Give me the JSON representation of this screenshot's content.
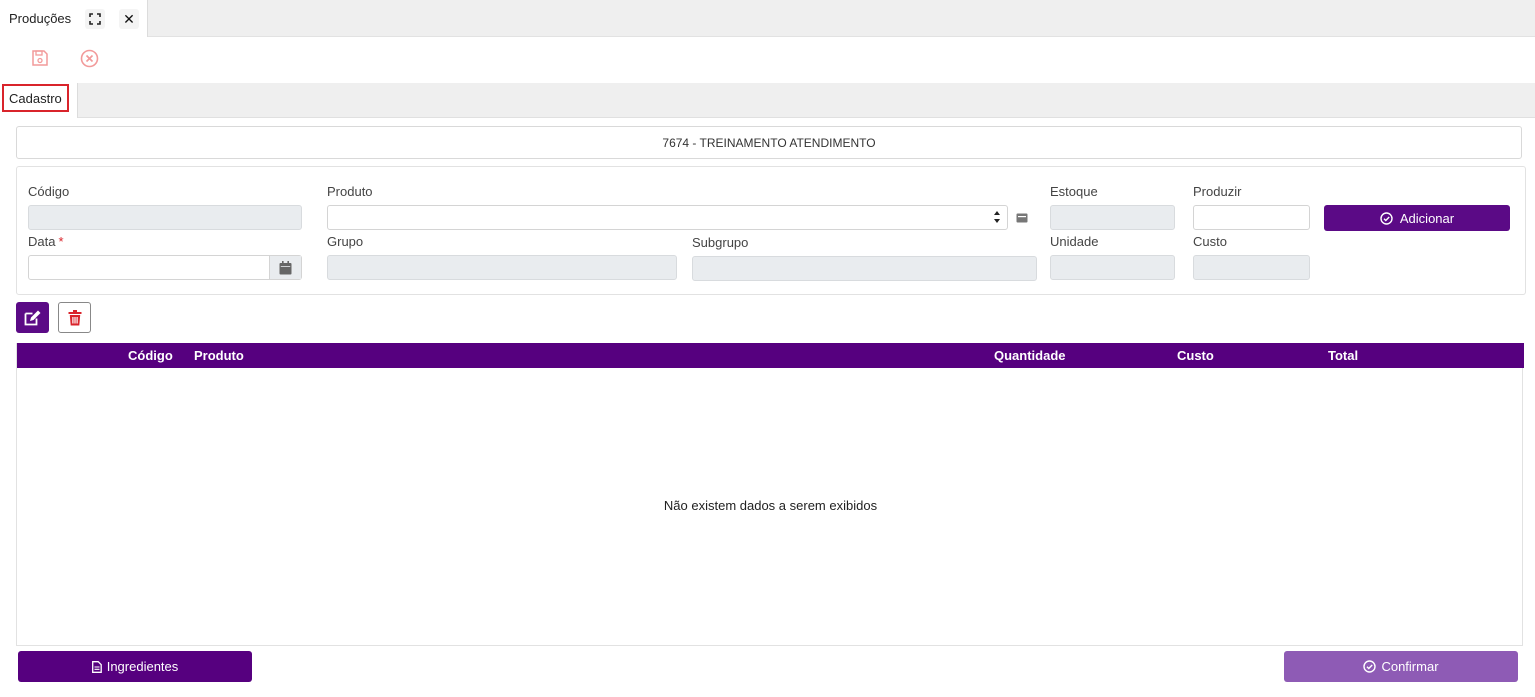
{
  "window": {
    "tab_title": "Produções",
    "expand_icon": "expand-icon",
    "close_icon": "close-icon",
    "close_glyph": "✕"
  },
  "toolbar": {
    "save_icon": "save-icon",
    "cancel_icon": "cancel-icon"
  },
  "section_tabs": {
    "active": "Cadastro"
  },
  "record": {
    "title": "7674 - TREINAMENTO ATENDIMENTO"
  },
  "form": {
    "codigo": {
      "label": "Código",
      "value": ""
    },
    "produto": {
      "label": "Produto",
      "value": ""
    },
    "estoque": {
      "label": "Estoque",
      "value": ""
    },
    "produzir": {
      "label": "Produzir",
      "value": ""
    },
    "data": {
      "label": "Data",
      "required_mark": "*",
      "value": ""
    },
    "grupo": {
      "label": "Grupo",
      "value": ""
    },
    "subgrupo": {
      "label": "Subgrupo",
      "value": ""
    },
    "unidade": {
      "label": "Unidade",
      "value": ""
    },
    "custo": {
      "label": "Custo",
      "value": ""
    },
    "add_button": "Adicionar"
  },
  "grid": {
    "columns": [
      "Código",
      "Produto",
      "Quantidade",
      "Custo",
      "Total"
    ],
    "empty_message": "Não existem dados a serem exibidos",
    "rows": []
  },
  "footer": {
    "ingredients_button": "Ingredientes",
    "confirm_button": "Confirmar"
  },
  "colors": {
    "primary": "#56007f",
    "confirm": "#8e5bb5",
    "danger": "#d9242b"
  }
}
